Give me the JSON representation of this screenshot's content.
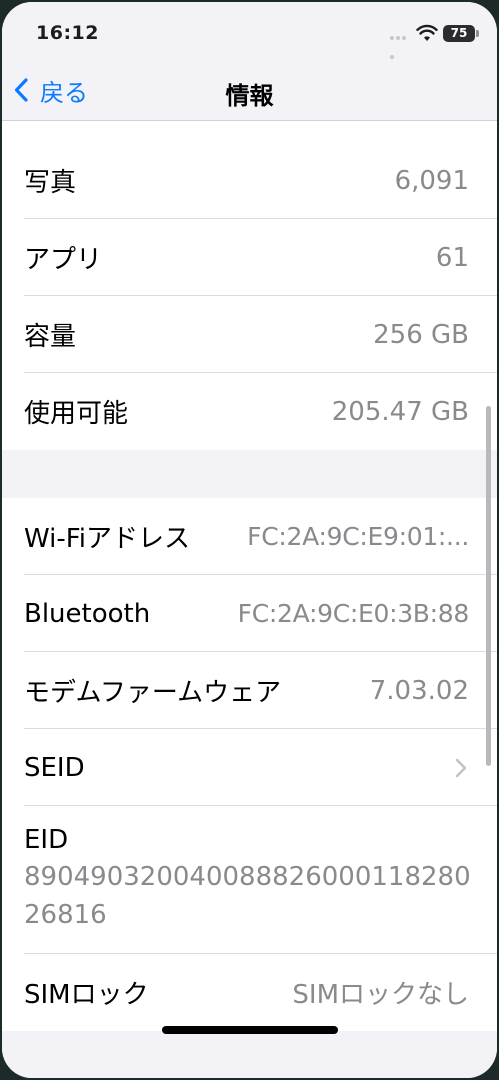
{
  "status_bar": {
    "time": "16:12",
    "battery": "75"
  },
  "nav": {
    "back_label": "戻る",
    "title": "情報"
  },
  "group_storage": [
    {
      "label": "写真",
      "value": "6,091"
    },
    {
      "label": "アプリ",
      "value": "61"
    },
    {
      "label": "容量",
      "value": "256 GB"
    },
    {
      "label": "使用可能",
      "value": "205.47 GB"
    }
  ],
  "group_network": {
    "wifi": {
      "label": "Wi-Fiアドレス",
      "value": "FC:2A:9C:E9:01:..."
    },
    "bluetooth": {
      "label": "Bluetooth",
      "value": "FC:2A:9C:E0:3B:88"
    },
    "modem": {
      "label": "モデムファームウェア",
      "value": "7.03.02"
    },
    "seid": {
      "label": "SEID"
    },
    "eid": {
      "label": "EID",
      "value": "89049032004008882600011828026816"
    },
    "sim_lock": {
      "label": "SIMロック",
      "value": "SIMロックなし"
    }
  },
  "icons": {
    "back": "chevron-left-icon",
    "disclosure": "chevron-right-icon",
    "wifi": "wifi-icon",
    "battery": "battery-icon"
  },
  "colors": {
    "accent": "#0a7aff",
    "value_text": "#8a8a8e",
    "grouped_background": "#f2f2f7"
  }
}
